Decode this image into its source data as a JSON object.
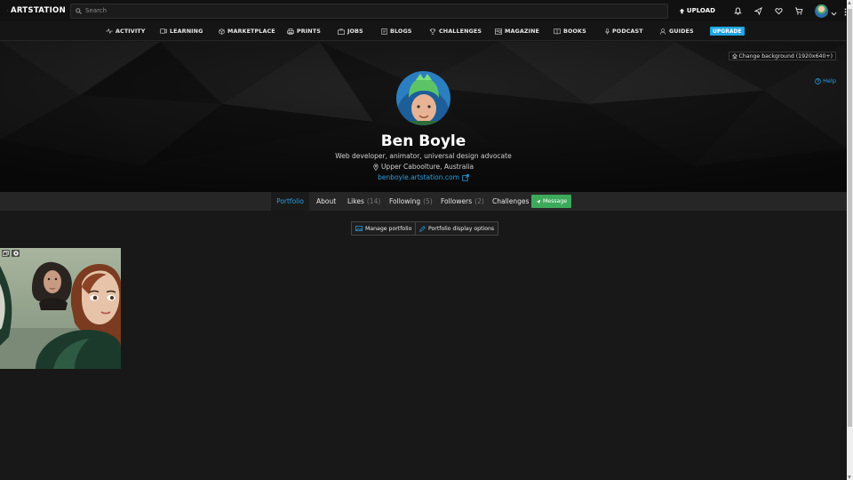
{
  "app": {
    "brand": "ARTSTATION"
  },
  "search": {
    "placeholder": "Search"
  },
  "header": {
    "upload_label": "UPLOAD"
  },
  "nav": {
    "items": [
      {
        "label": "ACTIVITY",
        "icon": "activity-icon"
      },
      {
        "label": "LEARNING",
        "icon": "learning-icon"
      },
      {
        "label": "MARKETPLACE",
        "icon": "marketplace-icon"
      },
      {
        "label": "PRINTS",
        "icon": "prints-icon"
      },
      {
        "label": "JOBS",
        "icon": "jobs-icon"
      },
      {
        "label": "BLOGS",
        "icon": "blogs-icon"
      },
      {
        "label": "CHALLENGES",
        "icon": "challenges-icon"
      },
      {
        "label": "MAGAZINE",
        "icon": "magazine-icon"
      },
      {
        "label": "BOOKS",
        "icon": "books-icon"
      },
      {
        "label": "PODCAST",
        "icon": "podcast-icon"
      },
      {
        "label": "GUIDES",
        "icon": "guides-icon"
      }
    ],
    "upgrade": "UPGRADE"
  },
  "hero": {
    "change_background": "Change background (1920x640+)",
    "help": "Help"
  },
  "profile": {
    "name": "Ben Boyle",
    "headline": "Web developer, animator, universal design advocate",
    "location": "Upper Caboolture, Australia",
    "website": "benboyle.artstation.com"
  },
  "tabs": [
    {
      "label": "Portfolio",
      "count": "",
      "active": true
    },
    {
      "label": "About",
      "count": ""
    },
    {
      "label": "Likes",
      "count": "(14)"
    },
    {
      "label": "Following",
      "count": "(5)"
    },
    {
      "label": "Followers",
      "count": "(2)"
    },
    {
      "label": "Challenges",
      "count": ""
    }
  ],
  "message_button": "Message",
  "portfolio_actions": {
    "manage": "Manage portfolio",
    "display_options": "Portfolio display options"
  },
  "colors": {
    "accent": "#2a9fe0",
    "upgrade": "#1fa6e2",
    "message": "#3da95a",
    "background": "#181818"
  }
}
